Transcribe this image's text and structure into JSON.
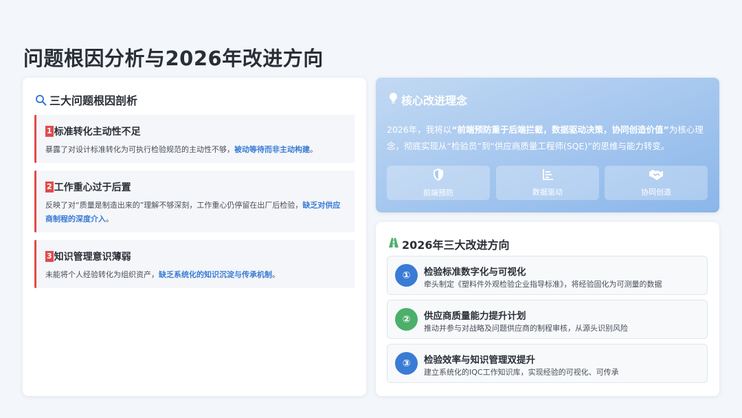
{
  "title": "问题根因分析与2026年改进方向",
  "root_causes": {
    "heading": "三大问题根因剖析",
    "items": [
      {
        "num": "1",
        "title": "标准转化主动性不足",
        "text": "暴露了对设计标准转化为可执行检验规范的主动性不够，",
        "highlight": "被动等待而非主动构建",
        "tail": "。"
      },
      {
        "num": "2",
        "title": "工作重心过于后置",
        "text": "反映了对“质量是制造出来的”理解不够深刻，工作重心仍停留在出厂后检验，",
        "highlight": "缺乏对供应商制程的深度介入",
        "tail": "。"
      },
      {
        "num": "3",
        "title": "知识管理意识薄弱",
        "text": "未能将个人经验转化为组织资产，",
        "highlight": "缺乏系统化的知识沉淀与传承机制",
        "tail": "。"
      }
    ]
  },
  "concept": {
    "heading": "核心改进理念",
    "prefix": "2026年，我将以",
    "quote": "“前端预防重于后端拦截，数据驱动决策，协同创造价值”",
    "suffix": "为核心理念，彻底实现从“检验员”到“供应商质量工程师(SQE)”的思维与能力转变。",
    "pillars": [
      {
        "label": "前端预防",
        "icon": "shield-icon"
      },
      {
        "label": "数据驱动",
        "icon": "chart-icon"
      },
      {
        "label": "协同创造",
        "icon": "handshake-icon"
      }
    ]
  },
  "directions": {
    "heading": "2026年三大改进方向",
    "items": [
      {
        "num": "①",
        "title": "检验标准数字化与可视化",
        "desc": "牵头制定《塑料件外观检验企业指导标准》，将经验固化为可测量的数据",
        "color": "#3a7bd5"
      },
      {
        "num": "②",
        "title": "供应商质量能力提升计划",
        "desc": "推动并参与对战略及问题供应商的制程审核，从源头识别风险",
        "color": "#4caf6a"
      },
      {
        "num": "③",
        "title": "检验效率与知识管理双提升",
        "desc": "建立系统化的IQC工作知识库，实现经验的可视化、可传承",
        "color": "#3a7bd5"
      }
    ]
  },
  "colors": {
    "accent_red": "#e14b4b",
    "accent_blue": "#3a7bd5",
    "accent_green": "#4caf6a",
    "background": "#f3f6fa"
  }
}
